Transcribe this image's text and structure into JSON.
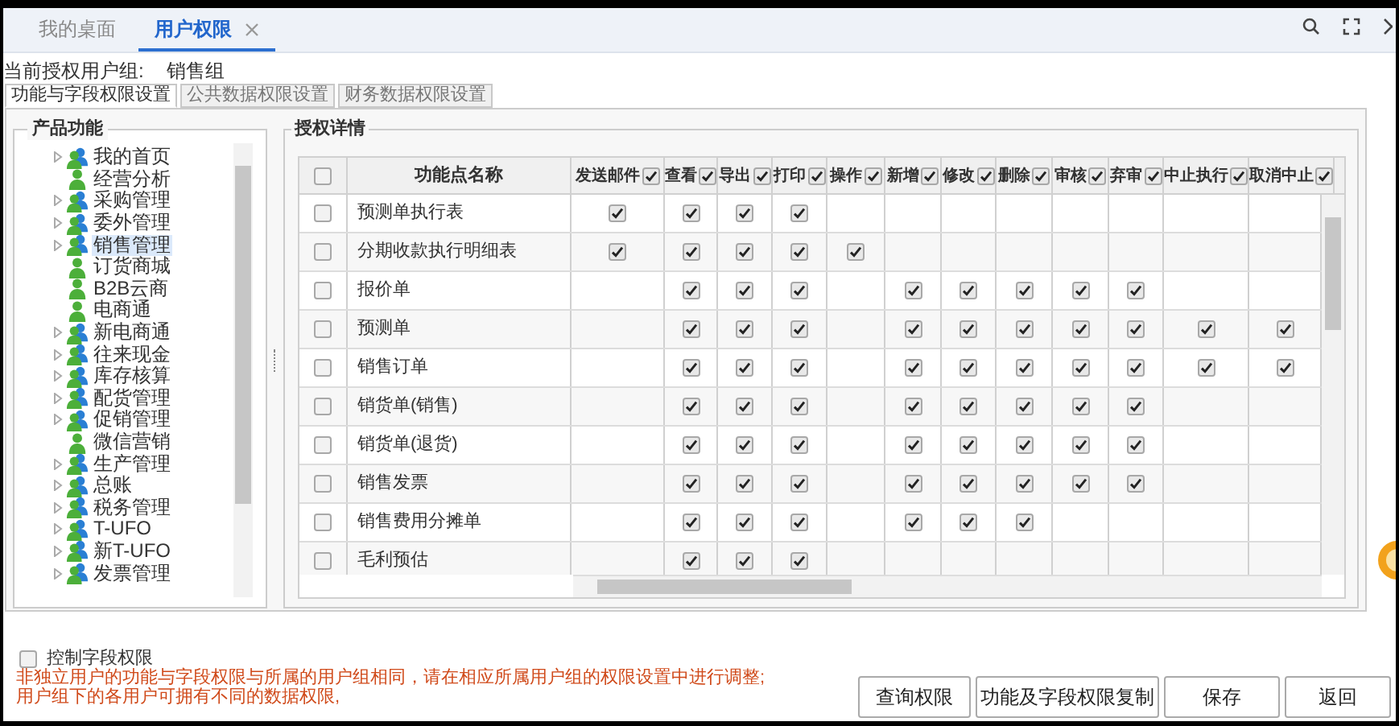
{
  "tabs": [
    {
      "label": "我的桌面",
      "selected": false,
      "closable": false
    },
    {
      "label": "用户权限",
      "selected": true,
      "closable": true
    }
  ],
  "user_group": {
    "label": "当前授权用户组:",
    "value": "销售组"
  },
  "sub_tabs": [
    {
      "label": "功能与字段权限设置",
      "selected": true
    },
    {
      "label": "公共数据权限设置",
      "selected": false
    },
    {
      "label": "财务数据权限设置",
      "selected": false
    }
  ],
  "product_panel": {
    "title": "产品功能",
    "items": [
      {
        "label": "我的首页",
        "kind": "group",
        "selected": false
      },
      {
        "label": "经营分析",
        "kind": "leaf",
        "selected": false
      },
      {
        "label": "采购管理",
        "kind": "group",
        "selected": false
      },
      {
        "label": "委外管理",
        "kind": "group",
        "selected": false
      },
      {
        "label": "销售管理",
        "kind": "group",
        "selected": true
      },
      {
        "label": "订货商城",
        "kind": "leaf",
        "selected": false
      },
      {
        "label": "B2B云商",
        "kind": "leaf",
        "selected": false
      },
      {
        "label": "电商通",
        "kind": "leaf",
        "selected": false
      },
      {
        "label": "新电商通",
        "kind": "group",
        "selected": false
      },
      {
        "label": "往来现金",
        "kind": "group",
        "selected": false
      },
      {
        "label": "库存核算",
        "kind": "group",
        "selected": false
      },
      {
        "label": "配货管理",
        "kind": "group",
        "selected": false
      },
      {
        "label": "促销管理",
        "kind": "group",
        "selected": false
      },
      {
        "label": "微信营销",
        "kind": "leaf",
        "selected": false
      },
      {
        "label": "生产管理",
        "kind": "group",
        "selected": false
      },
      {
        "label": "总账",
        "kind": "group",
        "selected": false
      },
      {
        "label": "税务管理",
        "kind": "group",
        "selected": false
      },
      {
        "label": "T-UFO",
        "kind": "group",
        "selected": false
      },
      {
        "label": "新T-UFO",
        "kind": "group",
        "selected": false
      },
      {
        "label": "发票管理",
        "kind": "group",
        "selected": false
      }
    ]
  },
  "detail_panel": {
    "title": "授权详情",
    "table": {
      "select_all": {
        "checked": false
      },
      "name_column": "功能点名称",
      "columns": [
        {
          "label": "发送邮件",
          "checked": true
        },
        {
          "label": "查看",
          "checked": true
        },
        {
          "label": "导出",
          "checked": true
        },
        {
          "label": "打印",
          "checked": true
        },
        {
          "label": "操作",
          "checked": true
        },
        {
          "label": "新增",
          "checked": true
        },
        {
          "label": "修改",
          "checked": true
        },
        {
          "label": "删除",
          "checked": true
        },
        {
          "label": "审核",
          "checked": true
        },
        {
          "label": "弃审",
          "checked": true
        },
        {
          "label": "中止执行",
          "checked": true
        },
        {
          "label": "取消中止",
          "checked": true
        }
      ],
      "rows": [
        {
          "name": "预测单执行表",
          "selected": false,
          "cells": [
            true,
            true,
            true,
            true,
            false,
            false,
            false,
            false,
            false,
            false,
            false,
            false
          ]
        },
        {
          "name": "分期收款执行明细表",
          "selected": false,
          "cells": [
            true,
            true,
            true,
            true,
            true,
            false,
            false,
            false,
            false,
            false,
            false,
            false
          ]
        },
        {
          "name": "报价单",
          "selected": false,
          "cells": [
            false,
            true,
            true,
            true,
            false,
            true,
            true,
            true,
            true,
            true,
            false,
            false
          ]
        },
        {
          "name": "预测单",
          "selected": false,
          "cells": [
            false,
            true,
            true,
            true,
            false,
            true,
            true,
            true,
            true,
            true,
            true,
            true
          ]
        },
        {
          "name": "销售订单",
          "selected": false,
          "cells": [
            false,
            true,
            true,
            true,
            false,
            true,
            true,
            true,
            true,
            true,
            true,
            true
          ]
        },
        {
          "name": "销货单(销售)",
          "selected": false,
          "cells": [
            false,
            true,
            true,
            true,
            false,
            true,
            true,
            true,
            true,
            true,
            false,
            false
          ]
        },
        {
          "name": "销货单(退货)",
          "selected": false,
          "cells": [
            false,
            true,
            true,
            true,
            false,
            true,
            true,
            true,
            true,
            true,
            false,
            false
          ]
        },
        {
          "name": "销售发票",
          "selected": false,
          "cells": [
            false,
            true,
            true,
            true,
            false,
            true,
            true,
            true,
            true,
            true,
            false,
            false
          ]
        },
        {
          "name": "销售费用分摊单",
          "selected": false,
          "cells": [
            false,
            true,
            true,
            true,
            false,
            true,
            true,
            true,
            false,
            false,
            false,
            false
          ]
        },
        {
          "name": "毛利预估",
          "selected": false,
          "cells": [
            false,
            true,
            true,
            true,
            false,
            false,
            false,
            false,
            false,
            false,
            false,
            false
          ]
        }
      ]
    }
  },
  "control_fields": {
    "label": "控制字段权限",
    "checked": false
  },
  "notes": [
    "非独立用户的功能与字段权限与所属的用户组相同，请在相应所属用户组的权限设置中进行调整;",
    "用户组下的各用户可拥有不同的数据权限,"
  ],
  "buttons": [
    "查询权限",
    "功能及字段权限复制",
    "保存",
    "返回"
  ]
}
